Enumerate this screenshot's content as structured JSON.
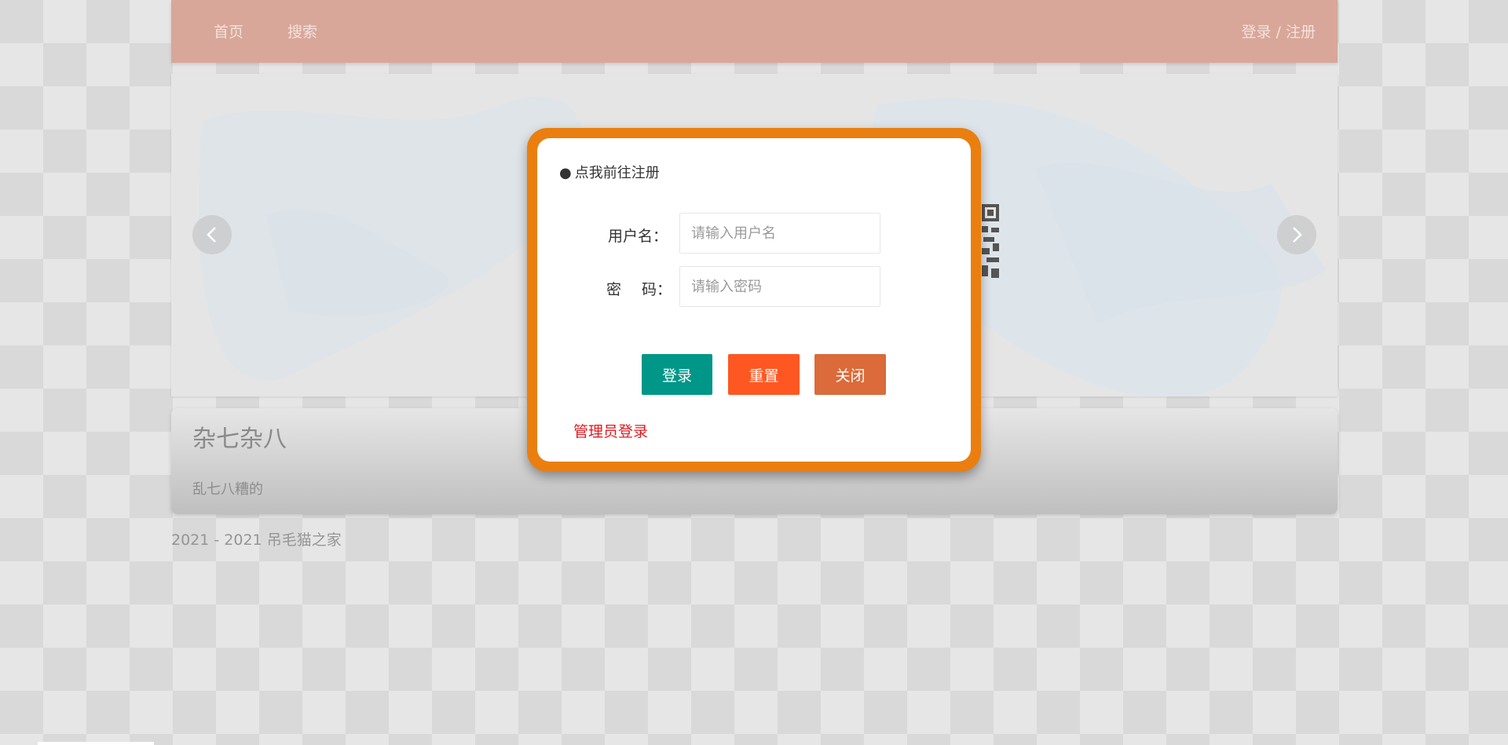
{
  "header": {
    "nav": [
      {
        "label": "首页"
      },
      {
        "label": "搜索"
      }
    ],
    "auth_label": "登录 / 注册",
    "bg_color": "#d8a799"
  },
  "carousel": {
    "prev_icon": "chevron-left-icon",
    "next_icon": "chevron-right-icon"
  },
  "card": {
    "title": "杂七杂八",
    "description": "乱七八糟的"
  },
  "footer": {
    "years": "2021 - 2021",
    "site_name": "吊毛猫之家"
  },
  "modal": {
    "border_color": "#ea7f0f",
    "register_bullet": "●",
    "register_link": "点我前往注册",
    "username_label": "用户名：",
    "username_placeholder": "请输入用户名",
    "username_value": "",
    "password_label_first": "密",
    "password_label_second": "码：",
    "password_placeholder": "请输入密码",
    "password_value": "",
    "buttons": {
      "login": {
        "label": "登录",
        "color": "#009688"
      },
      "reset": {
        "label": "重置",
        "color": "#ff5722"
      },
      "close": {
        "label": "关闭",
        "color": "#db6b3a"
      }
    },
    "admin_login": "管理员登录",
    "admin_color": "#e4191f"
  }
}
